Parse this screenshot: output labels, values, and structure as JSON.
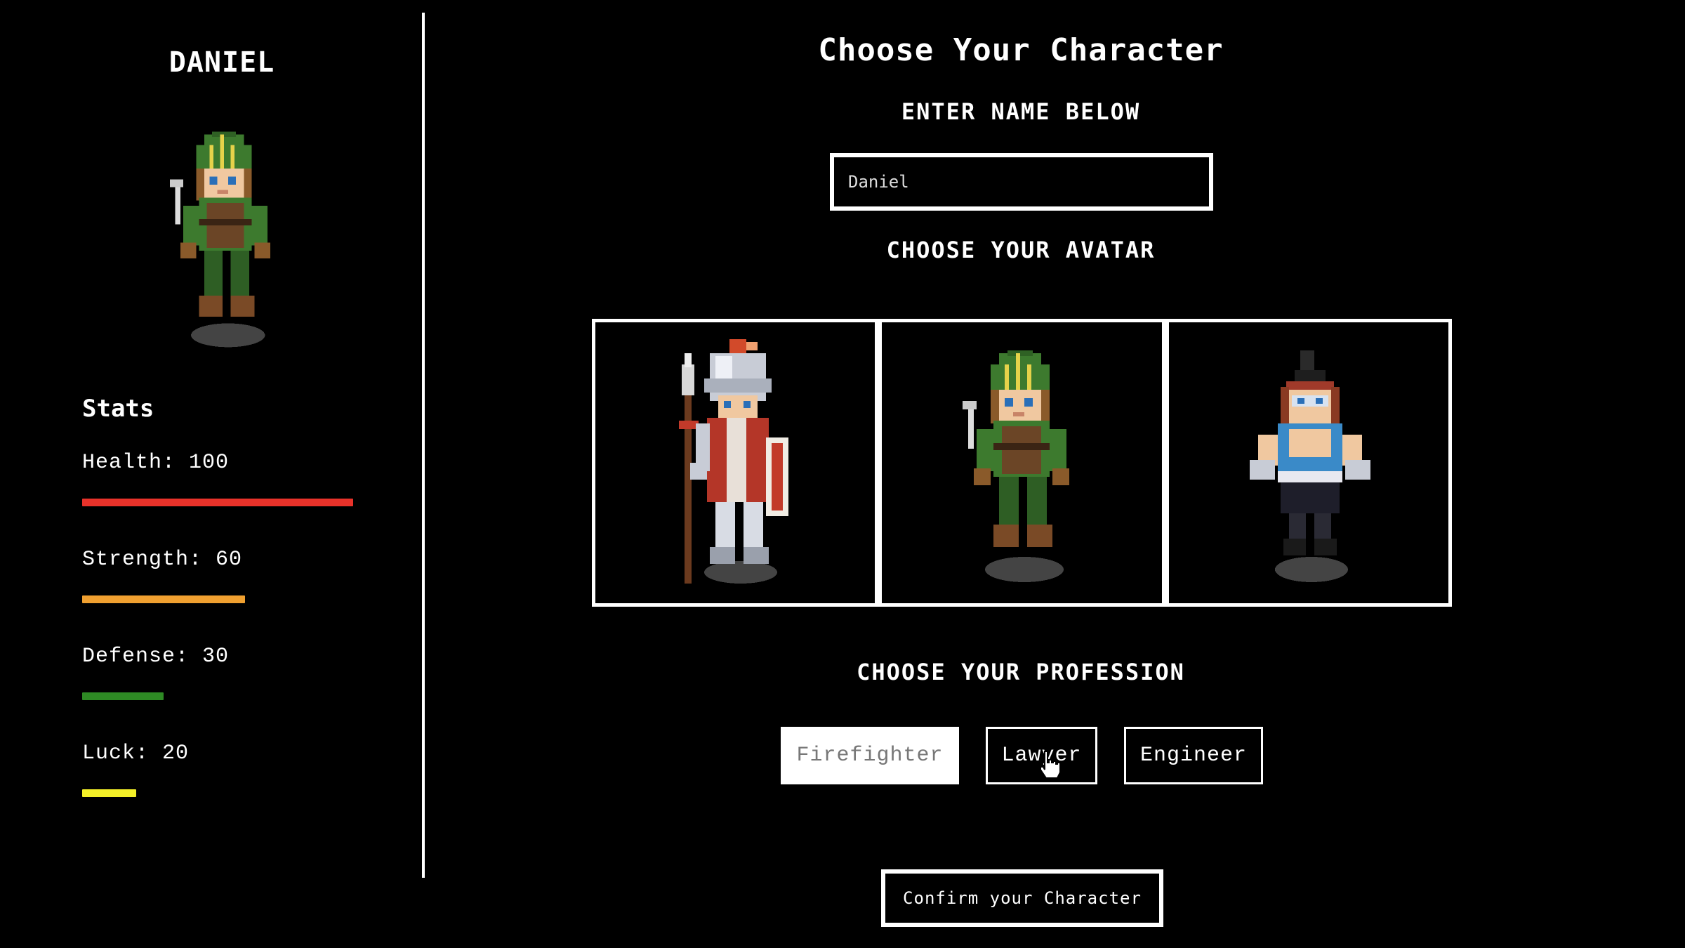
{
  "player": {
    "name": "DANIEL",
    "avatar": "ranger-avatar"
  },
  "stats": {
    "title": "Stats",
    "items": [
      {
        "label": "Health: 100",
        "value": 100,
        "color": "#e8322a"
      },
      {
        "label": "Strength: 60",
        "value": 60,
        "color": "#f0a030"
      },
      {
        "label": "Defense: 30",
        "value": 30,
        "color": "#2e8a24"
      },
      {
        "label": "Luck: 20",
        "value": 20,
        "color": "#f4f028"
      }
    ]
  },
  "main": {
    "title": "Choose Your Character",
    "name_heading": "ENTER NAME BELOW",
    "name_value": "Daniel",
    "avatar_heading": "CHOOSE YOUR AVATAR",
    "avatars": [
      "knight-avatar",
      "ranger-avatar",
      "warrior-avatar"
    ],
    "profession_heading": "CHOOSE YOUR PROFESSION",
    "professions": [
      {
        "label": "Firefighter",
        "selected": true
      },
      {
        "label": "Lawyer",
        "selected": false
      },
      {
        "label": "Engineer",
        "selected": false
      }
    ],
    "confirm_label": "Confirm your Character"
  },
  "colors": {
    "background": "#000000",
    "foreground": "#ffffff"
  }
}
